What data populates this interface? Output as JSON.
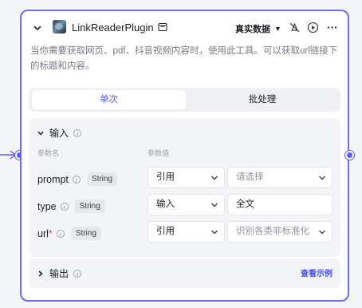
{
  "node": {
    "title": "LinkReaderPlugin",
    "mode_label": "真实数据",
    "description": "当你需要获取网页、pdf、抖音视频内容时，使用此工具。可以获取url链接下的标题和内容。"
  },
  "tabs": [
    {
      "label": "单次",
      "active": true
    },
    {
      "label": "批处理",
      "active": false
    }
  ],
  "input_section": {
    "title": "输入",
    "col_param_name": "参数名",
    "col_param_value": "参数值",
    "params": [
      {
        "name": "prompt",
        "required": false,
        "type": "String",
        "source": "引用",
        "value": "请选择",
        "value_is_placeholder": true,
        "value_has_dropdown": true
      },
      {
        "name": "type",
        "required": false,
        "type": "String",
        "source": "输入",
        "value": "全文",
        "value_is_placeholder": false,
        "value_has_dropdown": false
      },
      {
        "name": "url",
        "required": true,
        "type": "String",
        "source": "引用",
        "value": "识别各类非标准化",
        "value_is_placeholder": true,
        "value_has_dropdown": true
      }
    ]
  },
  "output_section": {
    "title": "输出",
    "example_link": "查看示例"
  },
  "colors": {
    "accent": "#5a5cf0",
    "border": "#6a6cf1",
    "required": "#e5484d"
  }
}
